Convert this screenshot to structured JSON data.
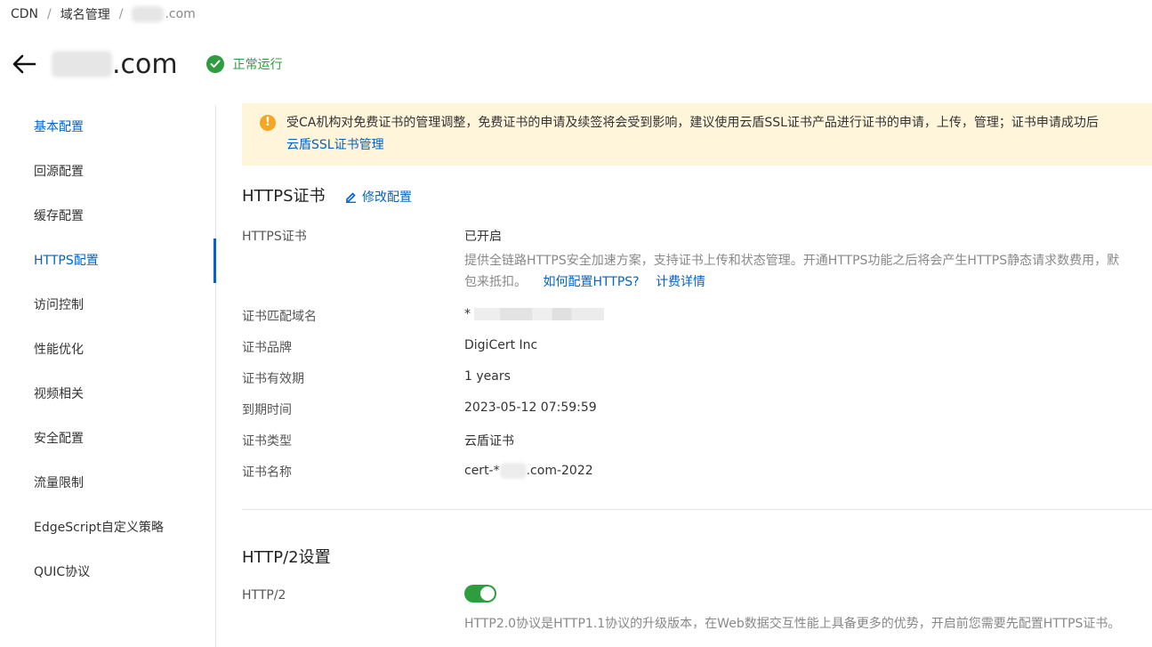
{
  "breadcrumb": {
    "items": [
      "CDN",
      "域名管理"
    ],
    "separator": "/",
    "domain_suffix": ".com"
  },
  "header": {
    "domain_suffix": ".com",
    "status": "正常运行",
    "back_icon": "arrow-left-icon",
    "status_icon": "check-circle-icon"
  },
  "sidebar": {
    "items": [
      {
        "label": "基本配置"
      },
      {
        "label": "回源配置"
      },
      {
        "label": "缓存配置"
      },
      {
        "label": "HTTPS配置"
      },
      {
        "label": "访问控制"
      },
      {
        "label": "性能优化"
      },
      {
        "label": "视频相关"
      },
      {
        "label": "安全配置"
      },
      {
        "label": "流量限制"
      },
      {
        "label": "EdgeScript自定义策略"
      },
      {
        "label": "QUIC协议"
      }
    ]
  },
  "notice": {
    "line1": "受CA机构对免费证书的管理调整，免费证书的申请及续签将会受到影响，建议使用云盾SSL证书产品进行证书的申请，上传，管理；证书申请成功后",
    "link": "云盾SSL证书管理"
  },
  "https_section": {
    "title": "HTTPS证书",
    "edit_label": "修改配置",
    "cert_label": "HTTPS证书",
    "cert_value": "已开启",
    "desc_line1": "提供全链路HTTPS安全加速方案，支持证书上传和状态管理。开通HTTPS功能之后将会产生HTTPS静态请求数费用，默",
    "desc_line2": "包来抵扣。",
    "link_how": "如何配置HTTPS?",
    "link_billing": "计费详情",
    "rows": [
      {
        "label": "证书匹配域名",
        "value": "*"
      },
      {
        "label": "证书品牌",
        "value": "DigiCert Inc"
      },
      {
        "label": "证书有效期",
        "value": "1 years"
      },
      {
        "label": "到期时间",
        "value": "2023-05-12 07:59:59"
      },
      {
        "label": "证书类型",
        "value": "云盾证书"
      },
      {
        "label": "证书名称",
        "value_prefix": "cert-*",
        "value_suffix": ".com-2022"
      }
    ]
  },
  "http2_section": {
    "title": "HTTP/2设置",
    "label": "HTTP/2",
    "enabled": true,
    "desc": "HTTP2.0协议是HTTP1.1协议的升级版本，在Web数据交互性能上具备更多的优势，开启前您需要先配置HTTPS证书。"
  },
  "colors": {
    "accent": "#0064c8",
    "success": "#2e9d3f",
    "notice_bg": "#fff5db",
    "warning": "#f5a623"
  }
}
